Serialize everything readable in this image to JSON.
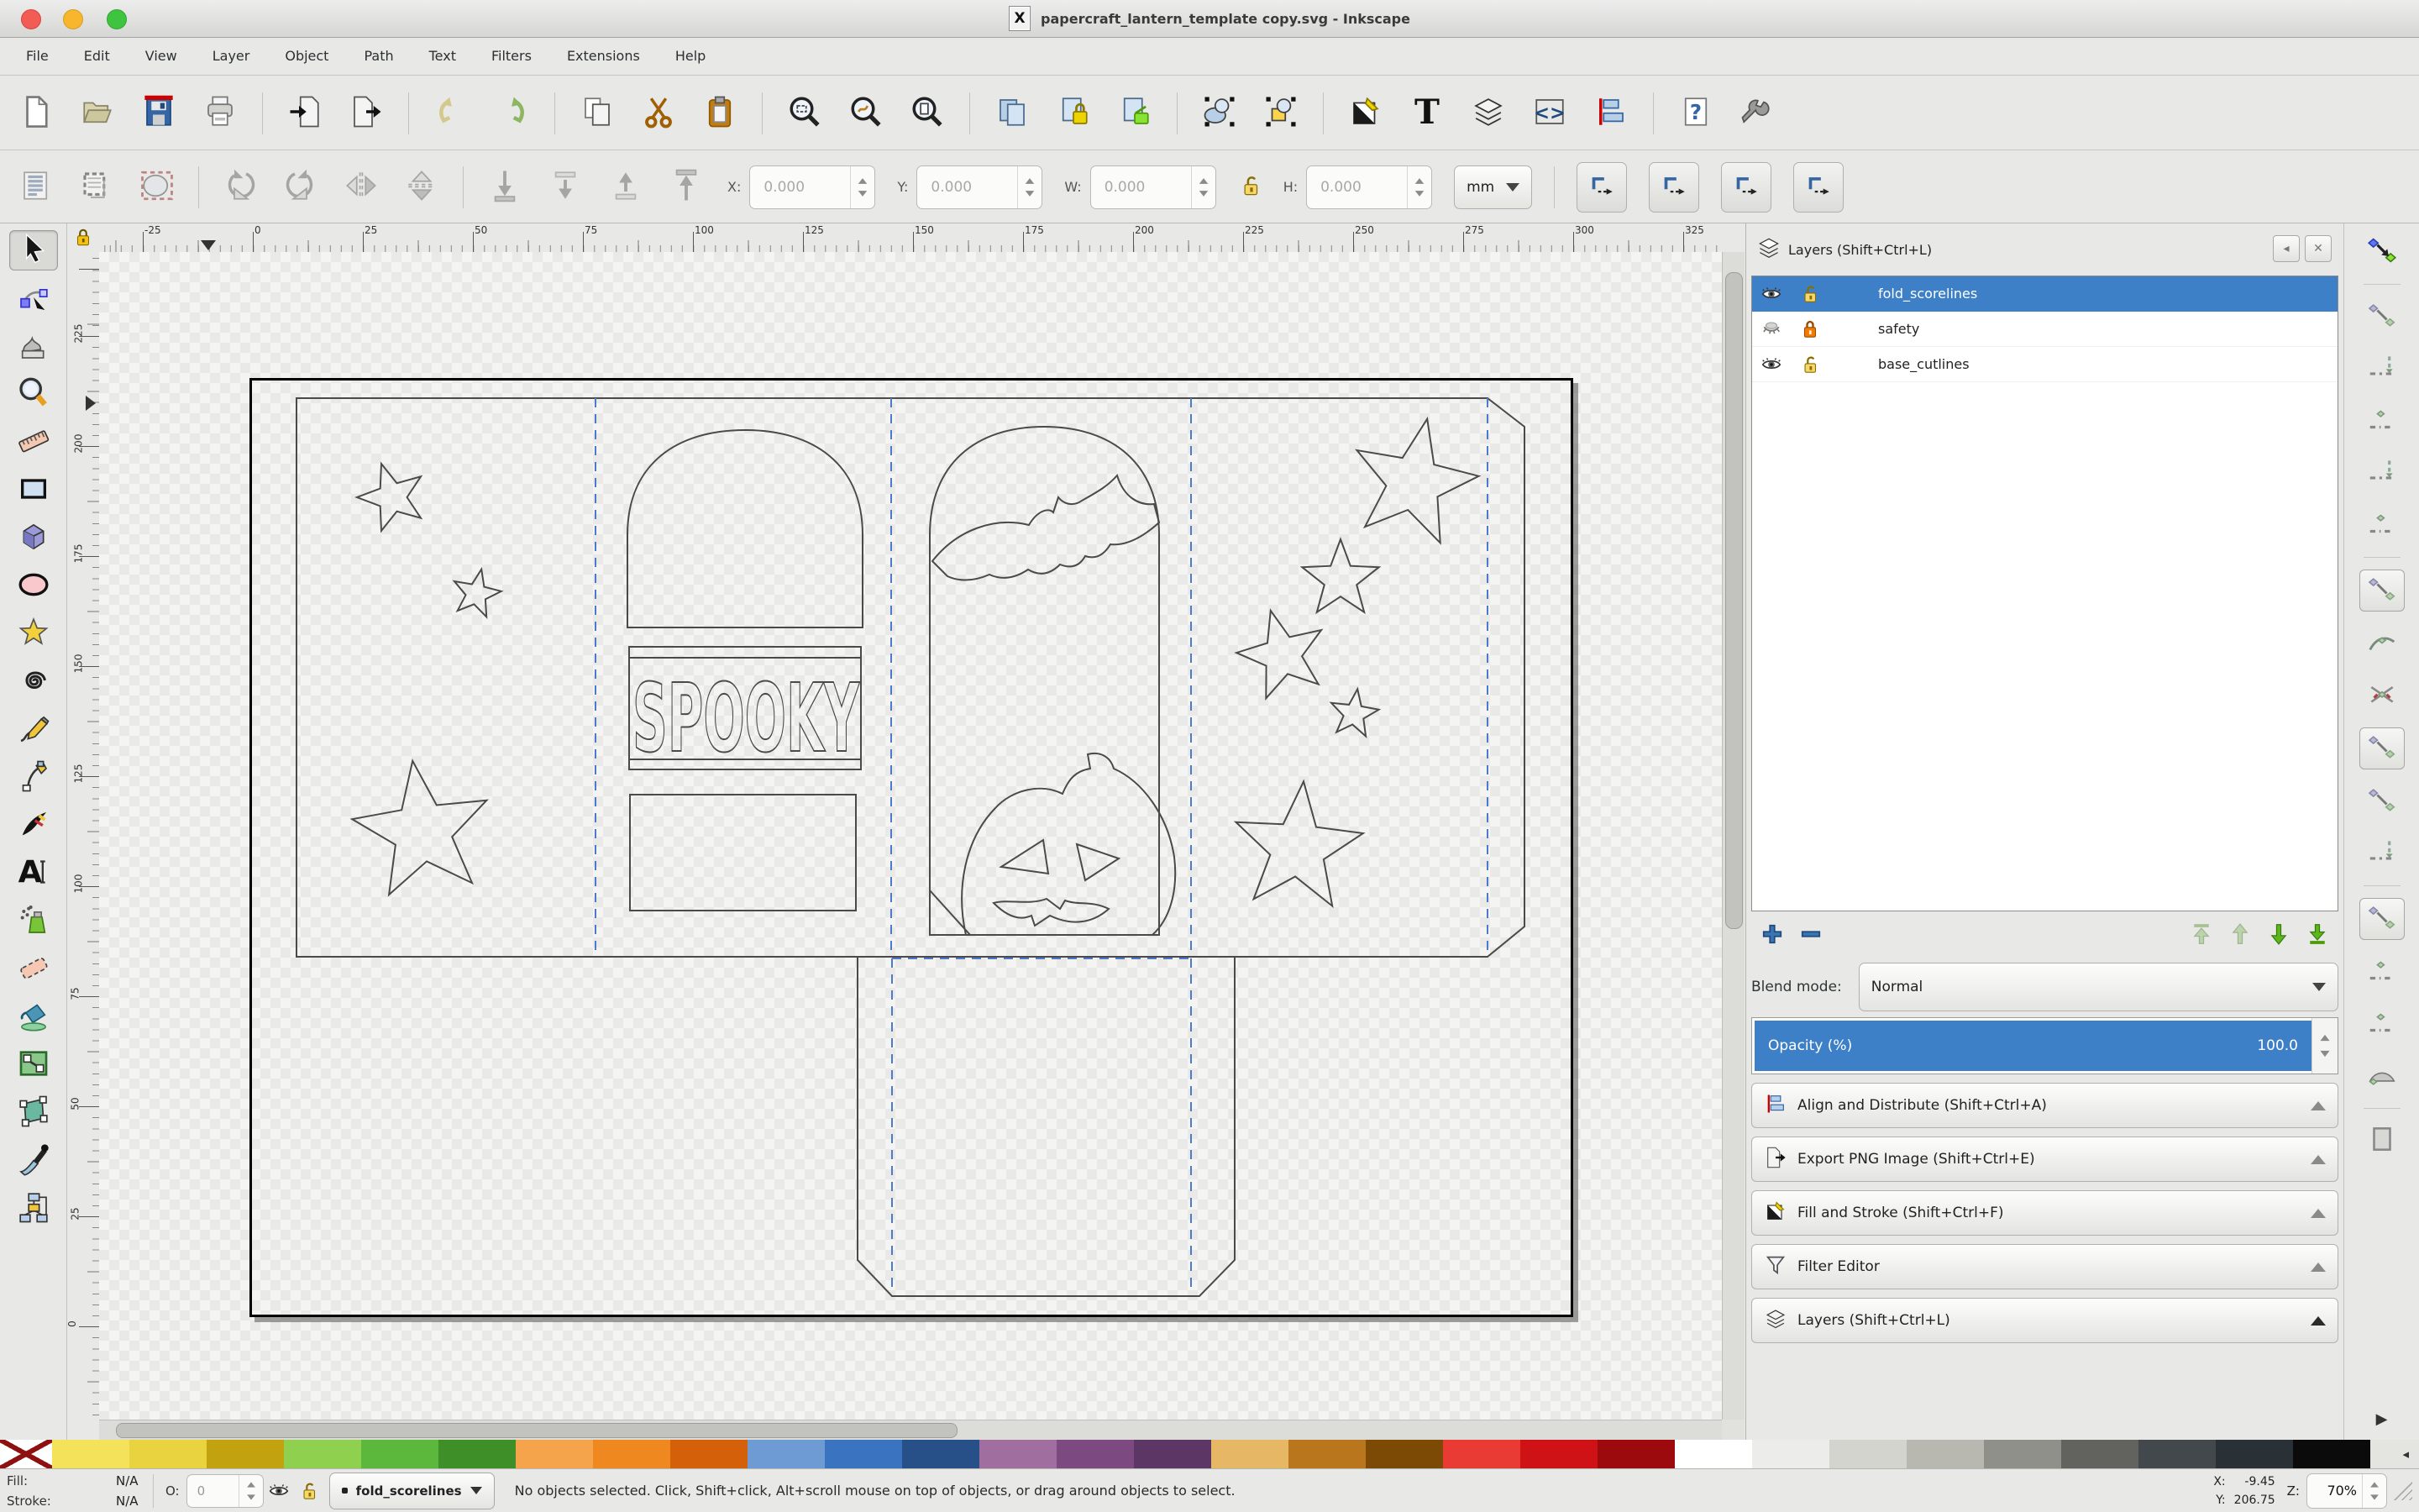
{
  "window": {
    "title": "papercraft_lantern_template copy.svg - Inkscape",
    "logo_glyph": "X"
  },
  "menu": {
    "items": [
      "File",
      "Edit",
      "View",
      "Layer",
      "Object",
      "Path",
      "Text",
      "Filters",
      "Extensions",
      "Help"
    ]
  },
  "command_toolbar": {
    "icons": [
      "new",
      "open",
      "save",
      "print",
      "|",
      "import",
      "export",
      "|",
      "undo",
      "redo",
      "|",
      "copy",
      "cut",
      "paste",
      "|",
      "zoom-selection",
      "zoom-drawing",
      "zoom-page",
      "|",
      "duplicate",
      "clone",
      "unlink-clone",
      "|",
      "group",
      "ungroup",
      "|",
      "fill-stroke-dialog",
      "text-dialog",
      "layers-dialog",
      "xml-editor",
      "align-dialog",
      "|",
      "document-properties",
      "preferences"
    ]
  },
  "tool_controls": {
    "buttons": [
      "select-all",
      "select-all-layers",
      "deselect",
      "|",
      "rotate-ccw",
      "rotate-cw",
      "flip-horizontal",
      "flip-vertical",
      "|",
      "lower-to-bottom",
      "lower",
      "raise",
      "raise-to-top"
    ],
    "fields": [
      {
        "label": "X:",
        "value": "0.000"
      },
      {
        "label": "Y:",
        "value": "0.000"
      },
      {
        "label": "W:",
        "value": "0.000"
      },
      {
        "label": "H:",
        "value": "0.000"
      }
    ],
    "unit": "mm",
    "affect_buttons": [
      "move-transform",
      "transform-corners",
      "transform-gradients",
      "transform-patterns"
    ]
  },
  "toolbox": {
    "tools": [
      "selector",
      "node-editor",
      "tweak",
      "zoom",
      "measure",
      "rectangle",
      "box-3d",
      "ellipse",
      "star",
      "spiral",
      "pencil",
      "pen",
      "calligraphy",
      "text",
      "spray",
      "eraser",
      "paint-bucket",
      "gradient",
      "mesh-gradient",
      "dropper",
      "connector"
    ],
    "active": "selector"
  },
  "rulers": {
    "horizontal_labels": [
      "-25",
      "0",
      "25",
      "50",
      "75",
      "100",
      "125",
      "150",
      "175",
      "200",
      "225",
      "250",
      "275",
      "300",
      "325"
    ],
    "vertical_labels": [
      "225",
      "200",
      "175",
      "150",
      "125",
      "100",
      "75",
      "50",
      "25",
      "0"
    ]
  },
  "layers_panel": {
    "title": "Layers (Shift+Ctrl+L)",
    "layers": [
      {
        "name": "fold_scorelines",
        "visible": true,
        "locked": false,
        "selected": true
      },
      {
        "name": "safety",
        "visible": false,
        "locked": true,
        "selected": false
      },
      {
        "name": "base_cutlines",
        "visible": true,
        "locked": false,
        "selected": false
      }
    ],
    "blend_label": "Blend mode:",
    "blend_value": "Normal",
    "opacity_label": "Opacity (%)",
    "opacity_value": "100.0"
  },
  "dialog_bars": [
    {
      "label": "Align and Distribute (Shift+Ctrl+A)",
      "icon": "align-dialog"
    },
    {
      "label": "Export PNG Image (Shift+Ctrl+E)",
      "icon": "export"
    },
    {
      "label": "Fill and Stroke (Shift+Ctrl+F)",
      "icon": "fill-stroke-dialog"
    },
    {
      "label": "Filter Editor",
      "icon": "funnel"
    },
    {
      "label": "Layers (Shift+Ctrl+L)",
      "icon": "layers-dialog"
    }
  ],
  "snap_toolbar": {
    "items": [
      "snap-enable",
      "|",
      "snap-bbox",
      "snap-bbox-edges",
      "snap-bbox-corners",
      "snap-bbox-midpoints",
      "snap-bbox-centers",
      "|",
      "snap-nodes",
      "snap-paths",
      "snap-path-intersections",
      "snap-cusp-nodes",
      "snap-smooth-nodes",
      "snap-midpoints",
      "|",
      "snap-others",
      "snap-object-centers",
      "snap-rotation-centers",
      "snap-text-baselines",
      "|",
      "snap-page-border"
    ]
  },
  "palette": {
    "colors": [
      "#f3e25a",
      "#e9d33e",
      "#c2a30f",
      "#8fd14f",
      "#5cb83c",
      "#3f8f28",
      "#f6a44c",
      "#f08820",
      "#d4610a",
      "#6f9bd4",
      "#3a74c0",
      "#274f88",
      "#a06fa0",
      "#7c4a80",
      "#5c3766",
      "#e6b765",
      "#b9761d",
      "#7d4a06",
      "#e93a34",
      "#ce1216",
      "#9c0a0e",
      "#ffffff",
      "#ececea",
      "#d4d4cf",
      "#b8b8b0",
      "#90908a",
      "#62625e",
      "#43484c",
      "#293036",
      "#0b0b0b"
    ],
    "scroll_arrow": "◂"
  },
  "statusbar": {
    "fill_label": "Fill:",
    "fill_value": "N/A",
    "stroke_label": "Stroke:",
    "stroke_value": "N/A",
    "opacity_label": "O:",
    "opacity_value": "0",
    "layer_button": "fold_scorelines",
    "message": "No objects selected. Click, Shift+click, Alt+scroll mouse on top of objects, or drag around objects to select.",
    "x_label": "X:",
    "x_value": "-9.45",
    "y_label": "Y:",
    "y_value": "206.75",
    "z_label": "Z:",
    "zoom_value": "70%"
  },
  "canvas": {
    "spooky_text": "SPOOKY"
  },
  "colors": {
    "selection": "#3d80c8",
    "fold_line": "#4d7bc9",
    "outline": "#4a4a4a",
    "page_border": "#000000"
  }
}
